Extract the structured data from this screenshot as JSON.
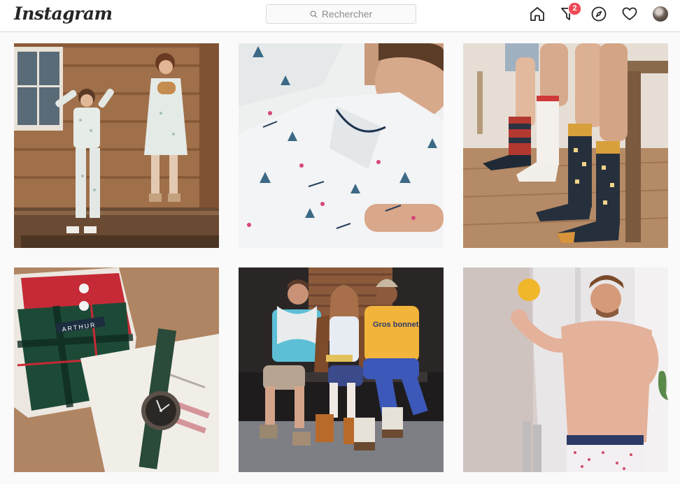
{
  "brand": {
    "logo_text": "Instagram"
  },
  "search": {
    "placeholder": "Rechercher"
  },
  "nav": {
    "home_icon": "home-icon",
    "activity_icon": "direct-filter-icon",
    "activity_badge": "2",
    "explore_icon": "compass-icon",
    "likes_icon": "heart-icon",
    "profile_icon": "avatar"
  },
  "posts": [
    {
      "subject": "post-1"
    },
    {
      "subject": "post-2"
    },
    {
      "subject": "post-3"
    },
    {
      "subject": "post-4",
      "visible_text": "ARTHUR"
    },
    {
      "subject": "post-5",
      "visible_text": "Gros bonnet"
    },
    {
      "subject": "post-6"
    }
  ],
  "colors": {
    "badge": "#ed4956",
    "border": "#dbdbdb",
    "background": "#fafafa"
  }
}
